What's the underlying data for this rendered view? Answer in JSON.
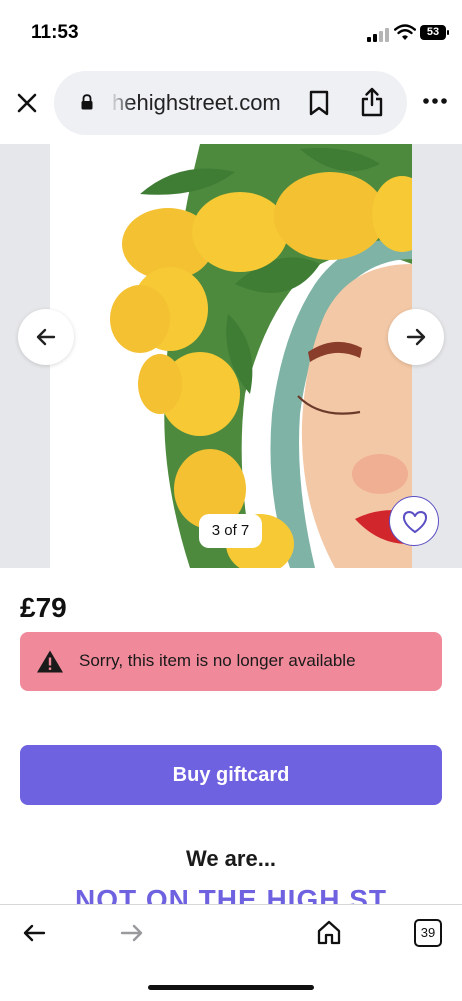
{
  "status_bar": {
    "time": "11:53",
    "battery": "53"
  },
  "browser": {
    "url_display": "hehighstreet.com"
  },
  "gallery": {
    "counter": "3 of 7"
  },
  "product": {
    "price": "£79"
  },
  "notice": {
    "text": "Sorry, this item is no longer available"
  },
  "actions": {
    "buy_giftcard": "Buy giftcard"
  },
  "footer": {
    "we_are": "We are...",
    "brand": "NOT ON THE HIGH ST"
  },
  "toolbar": {
    "tabs_count": "39"
  },
  "colors": {
    "accent": "#6e62e0",
    "notice_bg": "#f08a9a",
    "url_bar_bg": "#eef0f4"
  },
  "icons": [
    "close-icon",
    "lock-icon",
    "bookmark-icon",
    "share-icon",
    "more-icon",
    "arrow-left-icon",
    "arrow-right-icon",
    "heart-icon",
    "warning-icon",
    "back-icon",
    "forward-icon",
    "home-icon",
    "tabs-icon"
  ]
}
